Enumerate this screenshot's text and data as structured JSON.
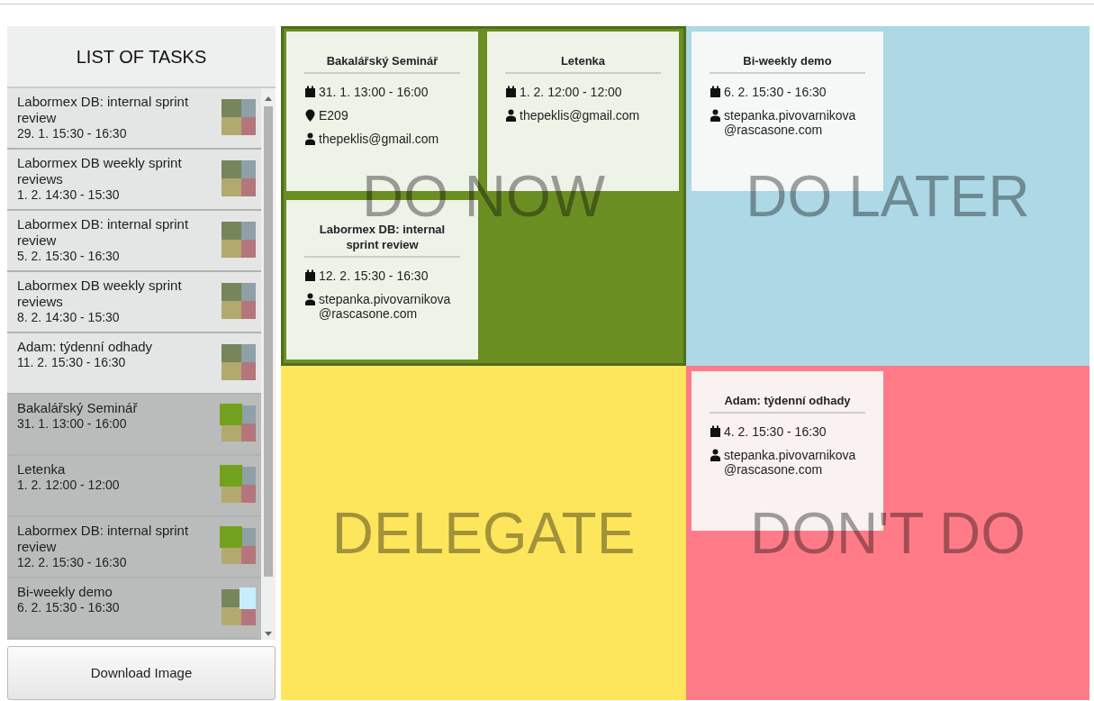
{
  "sidebar": {
    "title": "LIST OF TASKS",
    "tasks": [
      {
        "title": "Labormex DB: internal sprint review",
        "time": "29. 1. 15:30 - 16:30",
        "kind": "unplaced"
      },
      {
        "title": "Labormex DB weekly sprint reviews",
        "time": "1. 2. 14:30 - 15:30",
        "kind": "unplaced"
      },
      {
        "title": "Labormex DB: internal sprint review",
        "time": "5. 2. 15:30 - 16:30",
        "kind": "unplaced"
      },
      {
        "title": "Labormex DB weekly sprint reviews",
        "time": "8. 2. 14:30 - 15:30",
        "kind": "unplaced"
      },
      {
        "title": "Adam: týdenní odhady",
        "time": "11. 2. 15:30 - 16:30",
        "kind": "unplaced"
      },
      {
        "title": "Bakalářský Seminář",
        "time": "31. 1. 13:00 - 16:00",
        "kind": "do_now"
      },
      {
        "title": "Letenka",
        "time": "1. 2. 12:00 - 12:00",
        "kind": "do_now"
      },
      {
        "title": "Labormex DB: internal sprint review",
        "time": "12. 2. 15:30 - 16:30",
        "kind": "do_now"
      },
      {
        "title": "Bi-weekly demo",
        "time": "6. 2. 15:30 - 16:30",
        "kind": "do_later"
      }
    ],
    "download_button": "Download Image"
  },
  "matrix": {
    "rows": [
      {
        "quadrants": [
          {
            "label": "DO NOW",
            "color": "#6b8e23",
            "selected": true,
            "cards": [
              {
                "title": "Bakalářský Seminář",
                "time": "31. 1. 13:00 - 16:00",
                "location": "E209",
                "owner": "thepeklis@gmail.com"
              },
              {
                "title": "Letenka",
                "time": "1. 2. 12:00 - 12:00",
                "owner": "thepeklis@gmail.com"
              },
              {
                "title": "Labormex DB: internal sprint review",
                "time": "12. 2. 15:30 - 16:30",
                "owner": "stepanka.pivovarnikova @rascasone.com"
              }
            ]
          },
          {
            "label": "DO LATER",
            "color": "#add8e6",
            "selected": false,
            "cards": [
              {
                "title": "Bi-weekly demo",
                "time": "6. 2. 15:30 - 16:30",
                "owner": "stepanka.pivovarnikova @rascasone.com"
              }
            ]
          }
        ]
      },
      {
        "quadrants": [
          {
            "label": "DELEGATE",
            "color": "#fde65c",
            "selected": false
          },
          {
            "label": "DON'T DO",
            "color": "#ff7b87",
            "selected": false,
            "cards": [
              {
                "title": "Adam: týdenní odhady",
                "time": "4. 2. 15:30 - 16:30",
                "owner": "stepanka.pivovarnikova @rascasone.com"
              }
            ]
          }
        ]
      }
    ]
  }
}
